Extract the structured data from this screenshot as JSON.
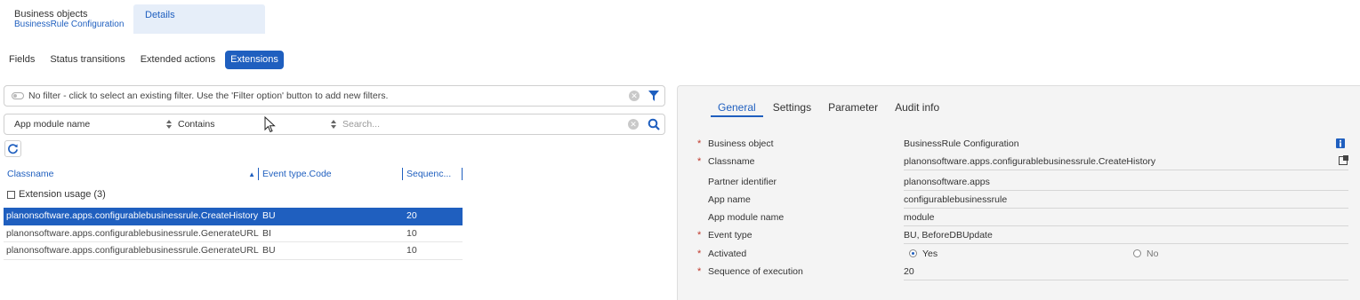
{
  "top_tabs": {
    "business_objects": "Business objects",
    "business_objects_sub": "BusinessRule Configuration",
    "details": "Details"
  },
  "subtabs": [
    "Fields",
    "Status transitions",
    "Extended actions",
    "Extensions"
  ],
  "active_subtab": "Extensions",
  "filter": {
    "text": "No filter - click to select an existing filter. Use the 'Filter option' button to add new filters."
  },
  "search": {
    "field": "App module name",
    "operator": "Contains",
    "placeholder": "Search..."
  },
  "grid": {
    "columns": [
      "Classname",
      "Event type.Code",
      "Sequenc..."
    ],
    "group_label": "Extension usage (3)",
    "rows": [
      {
        "classname": "planonsoftware.apps.configurablebusinessrule.CreateHistory",
        "event": "BU",
        "seq": "20",
        "selected": true
      },
      {
        "classname": "planonsoftware.apps.configurablebusinessrule.GenerateURL",
        "event": "BI",
        "seq": "10",
        "selected": false
      },
      {
        "classname": "planonsoftware.apps.configurablebusinessrule.GenerateURL",
        "event": "BU",
        "seq": "10",
        "selected": false
      }
    ]
  },
  "detail": {
    "tabs": [
      "General",
      "Settings",
      "Parameter",
      "Audit info"
    ],
    "active_tab": "General",
    "fields": {
      "business_object": {
        "label": "Business object",
        "value": "BusinessRule Configuration",
        "required": true
      },
      "classname": {
        "label": "Classname",
        "value": "planonsoftware.apps.configurablebusinessrule.CreateHistory",
        "required": true
      },
      "partner_identifier": {
        "label": "Partner identifier",
        "value": "planonsoftware.apps",
        "required": false
      },
      "app_name": {
        "label": "App name",
        "value": "configurablebusinessrule",
        "required": false
      },
      "app_module_name": {
        "label": "App module name",
        "value": "module",
        "required": false
      },
      "event_type": {
        "label": "Event type",
        "value": "BU, BeforeDBUpdate",
        "required": true
      },
      "activated": {
        "label": "Activated",
        "yes": "Yes",
        "no": "No",
        "selected": "Yes",
        "required": true
      },
      "sequence": {
        "label": "Sequence of execution",
        "value": "20",
        "required": true
      }
    }
  },
  "colors": {
    "accent": "#1f5fbf",
    "required": "#c0392b",
    "panel_bg": "#f4f4f4"
  },
  "icons": [
    "toggle-icon",
    "clear-icon",
    "filter-funnel-icon",
    "search-icon",
    "refresh-icon",
    "sort-up-icon",
    "info-icon",
    "popout-icon"
  ]
}
